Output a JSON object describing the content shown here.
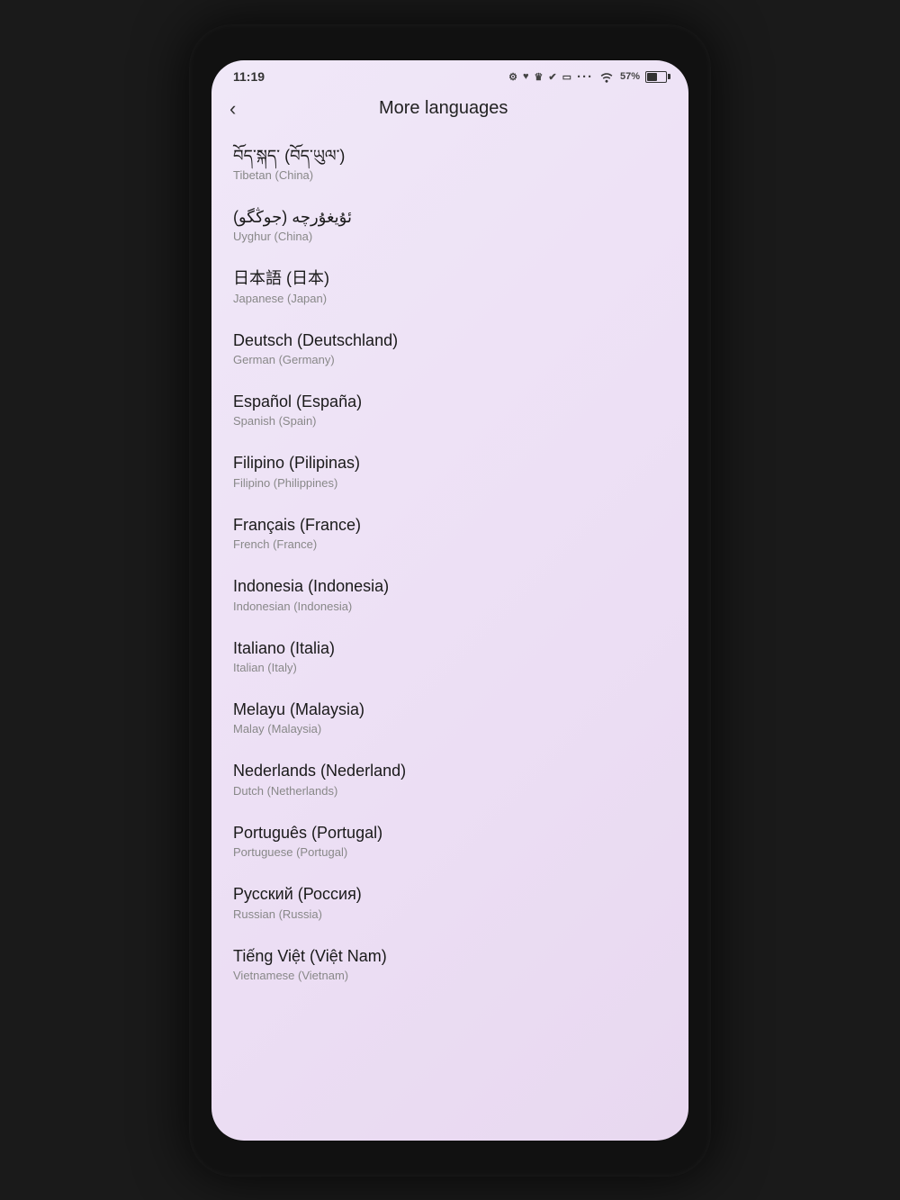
{
  "statusBar": {
    "time": "11:19",
    "battery": "57%",
    "batteryFill": 57
  },
  "header": {
    "backLabel": "‹",
    "title": "More languages"
  },
  "languages": [
    {
      "native": "བོད་སྐད་ (བོད་ཡུལ་)",
      "english": "Tibetan (China)"
    },
    {
      "native": "ئۇيغۇرچە (جوڭگو)",
      "english": "Uyghur (China)"
    },
    {
      "native": "日本語 (日本)",
      "english": "Japanese (Japan)"
    },
    {
      "native": "Deutsch (Deutschland)",
      "english": "German (Germany)"
    },
    {
      "native": "Español (España)",
      "english": "Spanish (Spain)"
    },
    {
      "native": "Filipino (Pilipinas)",
      "english": "Filipino (Philippines)"
    },
    {
      "native": "Français (France)",
      "english": "French (France)"
    },
    {
      "native": "Indonesia (Indonesia)",
      "english": "Indonesian (Indonesia)"
    },
    {
      "native": "Italiano (Italia)",
      "english": "Italian (Italy)"
    },
    {
      "native": "Melayu (Malaysia)",
      "english": "Malay (Malaysia)"
    },
    {
      "native": "Nederlands (Nederland)",
      "english": "Dutch (Netherlands)"
    },
    {
      "native": "Português (Portugal)",
      "english": "Portuguese (Portugal)"
    },
    {
      "native": "Русский (Россия)",
      "english": "Russian (Russia)"
    },
    {
      "native": "Tiếng Việt (Việt Nam)",
      "english": "Vietnamese (Vietnam)"
    }
  ]
}
